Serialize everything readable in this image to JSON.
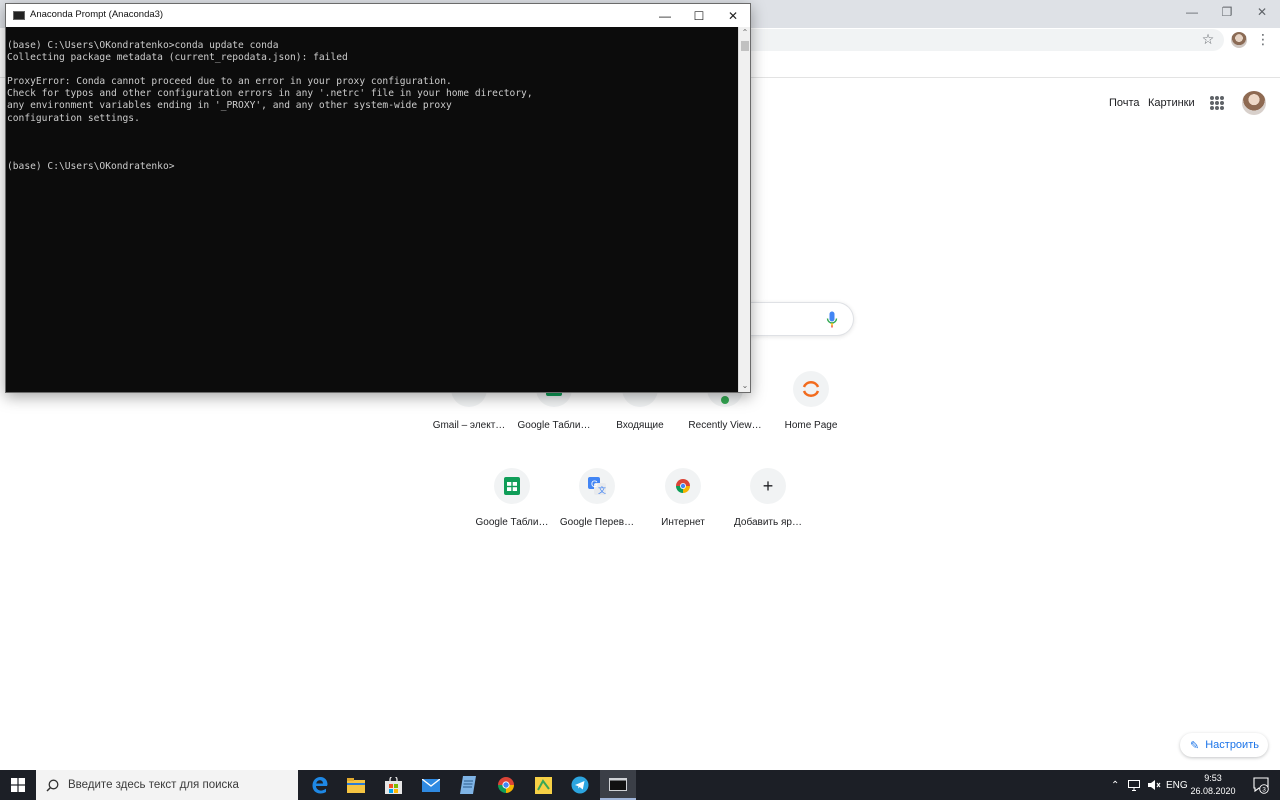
{
  "console": {
    "title": "Anaconda Prompt (Anaconda3)",
    "controls": {
      "minimize": "—",
      "maximize": "☐",
      "close": "✕"
    },
    "lines": [
      "(base) C:\\Users\\OKondratenko>conda update conda",
      "Collecting package metadata (current_repodata.json): failed",
      "",
      "ProxyError: Conda cannot proceed due to an error in your proxy configuration.",
      "Check for typos and other configuration errors in any '.netrc' file in your home directory,",
      "any environment variables ending in '_PROXY', and any other system-wide proxy",
      "configuration settings.",
      "",
      "",
      "",
      "(base) C:\\Users\\OKondratenko>"
    ]
  },
  "browser": {
    "window_controls": {
      "minimize": "—",
      "restore": "❐",
      "close": "✕"
    },
    "header_links": {
      "mail": "Почта",
      "images": "Картинки"
    },
    "shortcuts_row1": [
      {
        "label": "Gmail – элект…",
        "icon": "gmail-icon"
      },
      {
        "label": "Google Табли…",
        "icon": "google-sheets-icon"
      },
      {
        "label": "Входящие",
        "icon": "gmail-icon"
      },
      {
        "label": "Recently View…",
        "icon": "site-icon"
      },
      {
        "label": "Home Page",
        "icon": "orange-ring-icon"
      }
    ],
    "shortcuts_row2": [
      {
        "label": "Google Табли…",
        "icon": "google-sheets-icon"
      },
      {
        "label": "Google Перев…",
        "icon": "google-translate-icon"
      },
      {
        "label": "Интернет",
        "icon": "chrome-icon"
      },
      {
        "label": "Добавить яр…",
        "icon": "plus-icon"
      }
    ],
    "customize_label": "Настроить"
  },
  "taskbar": {
    "search_placeholder": "Введите здесь текст для поиска",
    "language": "ENG",
    "time": "9:53",
    "date": "26.08.2020",
    "notification_count": "3",
    "pinned_icons": [
      "edge-icon",
      "file-explorer-icon",
      "store-icon",
      "mail-icon",
      "notepad-icon",
      "chrome-icon",
      "sticky-app-icon",
      "telegram-icon",
      "console-icon"
    ]
  }
}
